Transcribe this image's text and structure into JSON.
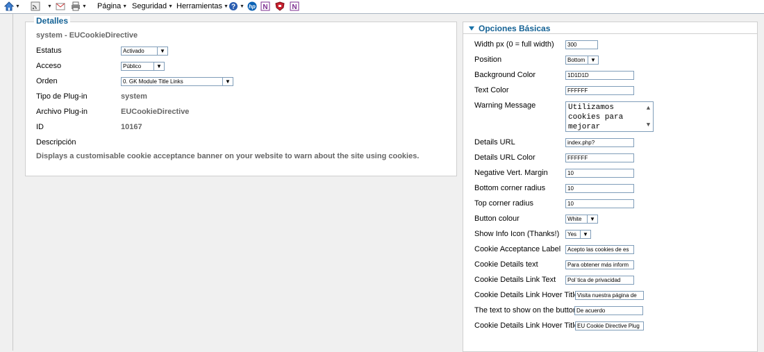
{
  "toolbar": {
    "page_label": "Página",
    "security_label": "Seguridad",
    "tools_label": "Herramientas"
  },
  "details": {
    "legend": "Detalles",
    "title": "system - EUCookieDirective",
    "status": {
      "label": "Estatus",
      "value": "Activado"
    },
    "access": {
      "label": "Acceso",
      "value": "Público"
    },
    "order": {
      "label": "Orden",
      "value": "0. GK Module Title Links"
    },
    "type": {
      "label": "Tipo de Plug-in",
      "value": "system"
    },
    "file": {
      "label": "Archivo Plug-in",
      "value": "EUCookieDirective"
    },
    "id": {
      "label": "ID",
      "value": "10167"
    },
    "description": {
      "label": "Descripción",
      "value": "Displays a customisable cookie acceptance banner on your website to warn about the site using cookies."
    }
  },
  "basic": {
    "heading": "Opciones Básicas",
    "width": {
      "label": "Width px (0 = full width)",
      "value": "300"
    },
    "position": {
      "label": "Position",
      "value": "Bottom"
    },
    "bgcolor": {
      "label": "Background Color",
      "value": "1D1D1D"
    },
    "textcolor": {
      "label": "Text Color",
      "value": "FFFFFF"
    },
    "warning": {
      "label": "Warning Message",
      "value": "Utilizamos cookies para mejorar"
    },
    "details_url": {
      "label": "Details URL",
      "value": "index.php?"
    },
    "details_url_color": {
      "label": "Details URL Color",
      "value": "FFFFFF"
    },
    "neg_margin": {
      "label": "Negative Vert. Margin",
      "value": "10"
    },
    "bottom_radius": {
      "label": "Bottom corner radius",
      "value": "10"
    },
    "top_radius": {
      "label": "Top corner radius",
      "value": "10"
    },
    "button_colour": {
      "label": "Button colour",
      "value": "White"
    },
    "show_info": {
      "label": "Show Info Icon (Thanks!)",
      "value": "Yes"
    },
    "accept_label": {
      "label": "Cookie Acceptance Label",
      "value": "Acepto las cookies de es"
    },
    "details_text": {
      "label": "Cookie Details text",
      "value": "Para obtener más inform"
    },
    "details_link_text": {
      "label": "Cookie Details Link Text",
      "value": "Pol˙tica de privacidad"
    },
    "hover_title_1": {
      "label": "Cookie Details Link Hover Title",
      "value": "Visita nuestra página de"
    },
    "button_text": {
      "label": "The text to show on the button",
      "value": "De acuerdo"
    },
    "hover_title_2": {
      "label": "Cookie Details Link Hover Title",
      "value": "EU Cookie Directive Plug"
    }
  }
}
